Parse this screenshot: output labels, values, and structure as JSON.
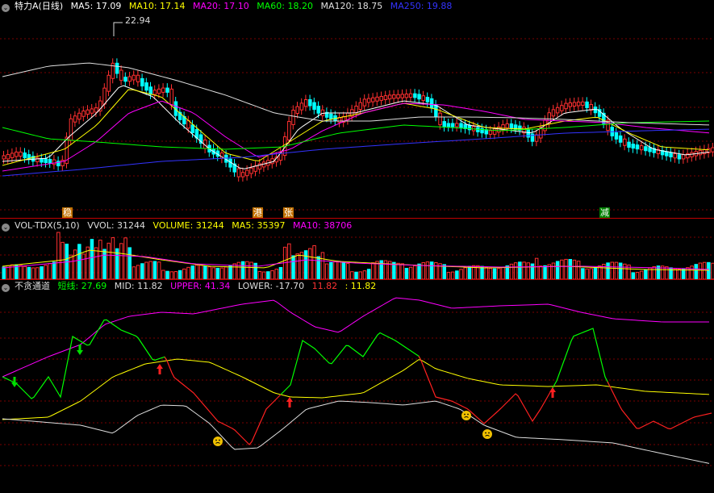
{
  "header": {
    "toggle_glyph": "⌄",
    "title": "特力A(日线)",
    "ma": [
      {
        "label": "MA5: 17.09",
        "color": "#ffffff"
      },
      {
        "label": "MA10: 17.14",
        "color": "#ffff00"
      },
      {
        "label": "MA20: 17.10",
        "color": "#ff00ff"
      },
      {
        "label": "MA60: 18.20",
        "color": "#00ff00"
      },
      {
        "label": "MA120: 18.75",
        "color": "#e0e0e0"
      },
      {
        "label": "MA250: 19.88",
        "color": "#3333ff"
      }
    ],
    "high_label": "22.94",
    "tags": [
      {
        "text": "稳",
        "bg": "#c07000",
        "fg": "#ffffff"
      },
      {
        "text": "港",
        "bg": "#c07000",
        "fg": "#ffffff"
      },
      {
        "text": "张",
        "bg": "#c07000",
        "fg": "#ffffff"
      },
      {
        "text": "减",
        "bg": "#008000",
        "fg": "#ffffff"
      }
    ]
  },
  "volume": {
    "title": "VOL-TDX(5,10)",
    "items": [
      {
        "label": "VVOL: 31244",
        "color": "#dddddd"
      },
      {
        "label": "VOLUME: 31244",
        "color": "#ffff00"
      },
      {
        "label": "MA5: 35397",
        "color": "#ffff00"
      },
      {
        "label": "MA10: 38706",
        "color": "#ff00ff"
      }
    ]
  },
  "channel": {
    "title": "不贪通道",
    "items": [
      {
        "label": "短线: 27.69",
        "color": "#00ff00"
      },
      {
        "label": "MID: 11.82",
        "color": "#dddddd"
      },
      {
        "label": "UPPER: 41.34",
        "color": "#ff00ff"
      },
      {
        "label": "LOWER: -17.70",
        "color": "#dddddd"
      },
      {
        "label": "11.82",
        "color": "#ff3333"
      },
      {
        "label": ": 11.82",
        "color": "#ffff00"
      }
    ]
  },
  "colors": {
    "up": "#ff3030",
    "down": "#00ffff",
    "grid": "#7a0000"
  }
}
